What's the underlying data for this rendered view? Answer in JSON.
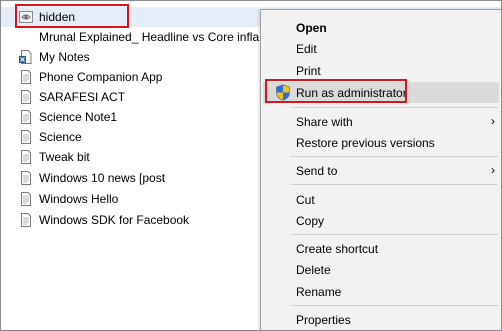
{
  "files": [
    {
      "name": "hidden",
      "icon": "hidden-file-icon",
      "selected": true
    },
    {
      "name": "Mrunal Explained_ Headline vs Core infla...",
      "icon": "none"
    },
    {
      "name": "My Notes",
      "icon": "notes-doc-icon"
    },
    {
      "name": "Phone Companion App",
      "icon": "text-doc-icon"
    },
    {
      "name": "SARAFESI ACT",
      "icon": "text-doc-icon"
    },
    {
      "name": "Science Note1",
      "icon": "text-doc-icon"
    },
    {
      "name": "Science",
      "icon": "text-doc-icon"
    },
    {
      "name": "Tweak bit",
      "icon": "text-doc-icon"
    },
    {
      "name": "Windows 10 news [post",
      "icon": "text-doc-icon"
    },
    {
      "name": "Windows Hello",
      "icon": "text-doc-icon"
    },
    {
      "name": "Windows SDK for Facebook",
      "icon": "text-doc-icon"
    }
  ],
  "context_menu": {
    "open": "Open",
    "edit": "Edit",
    "print": "Print",
    "run_as_admin": "Run as administrator",
    "share_with": "Share with",
    "restore_previous": "Restore previous versions",
    "send_to": "Send to",
    "cut": "Cut",
    "copy": "Copy",
    "create_shortcut": "Create shortcut",
    "delete": "Delete",
    "rename": "Rename",
    "properties": "Properties",
    "submenu_arrow": "›"
  },
  "colors": {
    "highlight_box": "#d8141e",
    "menu_background": "#f2f2f2",
    "menu_hover": "#dadada",
    "selection": "#e5eef8"
  }
}
